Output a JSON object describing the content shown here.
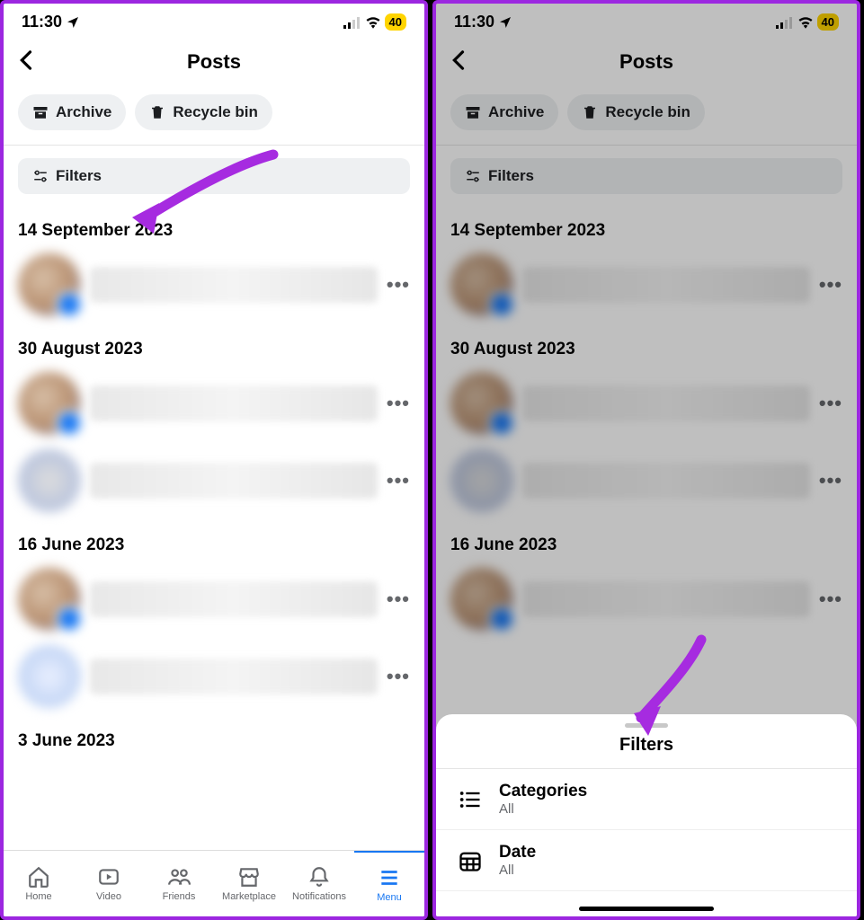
{
  "status": {
    "time": "11:30",
    "battery": "40"
  },
  "header": {
    "title": "Posts"
  },
  "chips": {
    "archive": "Archive",
    "recycle": "Recycle bin"
  },
  "filters_button": "Filters",
  "dates": {
    "d1": "14 September 2023",
    "d2": "30 August 2023",
    "d3": "16 June 2023",
    "d4": "3 June 2023"
  },
  "tabs": {
    "home": "Home",
    "video": "Video",
    "friends": "Friends",
    "marketplace": "Marketplace",
    "notifications": "Notifications",
    "menu": "Menu"
  },
  "sheet": {
    "title": "Filters",
    "categories_label": "Categories",
    "categories_value": "All",
    "date_label": "Date",
    "date_value": "All"
  },
  "dots": "•••"
}
